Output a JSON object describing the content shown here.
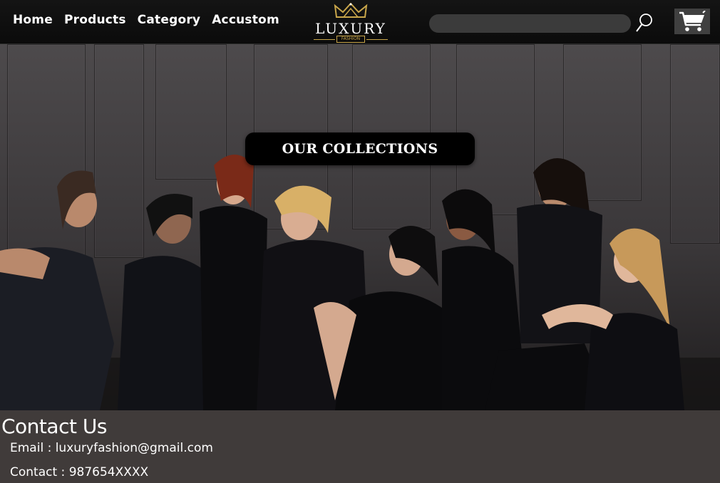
{
  "nav": {
    "home": "Home",
    "products": "Products",
    "category": "Category",
    "accustom": "Accustom"
  },
  "logo": {
    "word": "LUXURY",
    "sub": "FASHION",
    "accent_color": "#c9a64a"
  },
  "search": {
    "placeholder": "",
    "icon": "search-icon"
  },
  "cart": {
    "icon": "cart-icon"
  },
  "hero": {
    "button_label": "OUR COLLECTIONS"
  },
  "contact": {
    "heading": "Contact Us",
    "email_label": "Email : ",
    "email": "luxuryfashion@gmail.com",
    "phone_label": "Contact : ",
    "phone": "987654XXXX"
  }
}
